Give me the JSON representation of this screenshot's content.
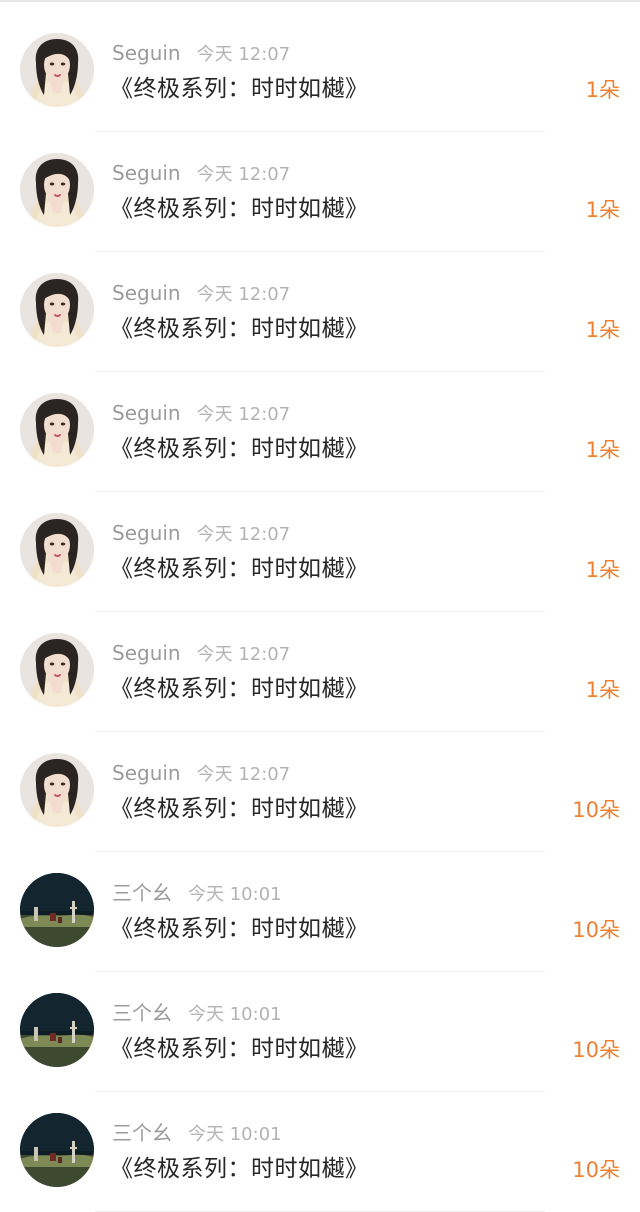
{
  "items": [
    {
      "user": "Seguin",
      "time": "今天 12:07",
      "title": "《终极系列：时时如樾》",
      "count": "1朵",
      "avatar": "woman-portrait-avatar"
    },
    {
      "user": "Seguin",
      "time": "今天 12:07",
      "title": "《终极系列：时时如樾》",
      "count": "1朵",
      "avatar": "woman-portrait-avatar"
    },
    {
      "user": "Seguin",
      "time": "今天 12:07",
      "title": "《终极系列：时时如樾》",
      "count": "1朵",
      "avatar": "woman-portrait-avatar"
    },
    {
      "user": "Seguin",
      "time": "今天 12:07",
      "title": "《终极系列：时时如樾》",
      "count": "1朵",
      "avatar": "woman-portrait-avatar"
    },
    {
      "user": "Seguin",
      "time": "今天 12:07",
      "title": "《终极系列：时时如樾》",
      "count": "1朵",
      "avatar": "woman-portrait-avatar"
    },
    {
      "user": "Seguin",
      "time": "今天 12:07",
      "title": "《终极系列：时时如樾》",
      "count": "1朵",
      "avatar": "woman-portrait-avatar"
    },
    {
      "user": "Seguin",
      "time": "今天 12:07",
      "title": "《终极系列：时时如樾》",
      "count": "10朵",
      "avatar": "woman-portrait-avatar"
    },
    {
      "user": "三个幺",
      "time": "今天 10:01",
      "title": "《终极系列：时时如樾》",
      "count": "10朵",
      "avatar": "night-field-avatar"
    },
    {
      "user": "三个幺",
      "time": "今天 10:01",
      "title": "《终极系列：时时如樾》",
      "count": "10朵",
      "avatar": "night-field-avatar"
    },
    {
      "user": "三个幺",
      "time": "今天 10:01",
      "title": "《终极系列：时时如樾》",
      "count": "10朵",
      "avatar": "night-field-avatar"
    }
  ],
  "colors": {
    "count": "#ee8132",
    "username": "#9b9b9b",
    "time": "#b3b3b3",
    "title": "#262626",
    "divider": "#efefef"
  }
}
